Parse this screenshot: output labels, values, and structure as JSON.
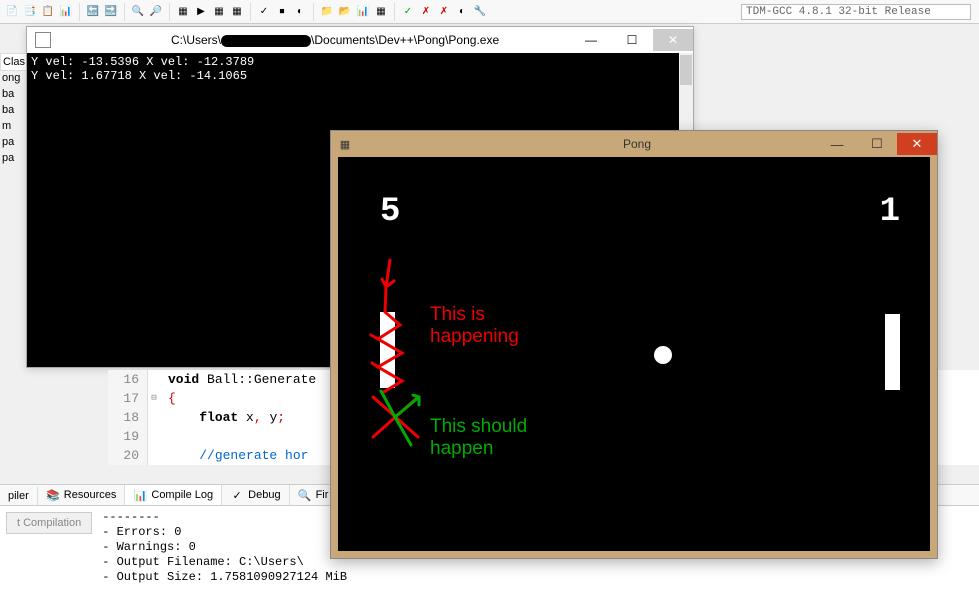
{
  "toolbar": {
    "compiler_dropdown": "TDM-GCC 4.8.1 32-bit Release"
  },
  "side": {
    "classes_label": "Clas",
    "tree": [
      "ong",
      "ba",
      "ba",
      "m",
      "pa",
      "pa"
    ]
  },
  "console": {
    "title": "C:\\Users\\               \\Documents\\Dev++\\Pong\\Pong.exe",
    "line1": "Y vel: -13.5396 X vel: -12.3789",
    "line2": "Y vel: 1.67718 X vel: -14.1065"
  },
  "code": {
    "lines": [
      {
        "n": "16",
        "text": "void Ball::Generate"
      },
      {
        "n": "17",
        "text": "{",
        "fold": "⊟"
      },
      {
        "n": "18",
        "text": "    float x, y;"
      },
      {
        "n": "19",
        "text": ""
      },
      {
        "n": "20",
        "text": "    //generate hor"
      }
    ]
  },
  "bottom_tabs": {
    "compiler": "piler",
    "resources": "Resources",
    "compile_log": "Compile Log",
    "debug": "Debug",
    "find": "Fir"
  },
  "abort_label": "t Compilation",
  "log": {
    "sep": "--------",
    "errors": "- Errors: 0",
    "warnings": "- Warnings: 0",
    "filename": "- Output Filename: C:\\Users\\",
    "size": "- Output Size: 1.7581090927124 MiB"
  },
  "pong": {
    "title": "Pong",
    "score_left": "5",
    "score_right": "1",
    "annot_red_1": "This is",
    "annot_red_2": "happening",
    "annot_green_1": "This should",
    "annot_green_2": "happen"
  }
}
